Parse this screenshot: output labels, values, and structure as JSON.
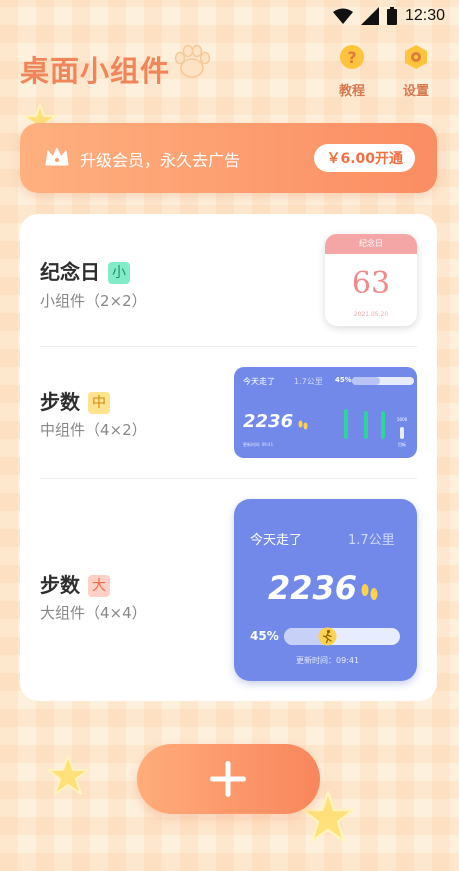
{
  "status_bar": {
    "time": "12:30"
  },
  "header": {
    "title": "桌面小组件",
    "tutorial_label": "教程",
    "settings_label": "设置"
  },
  "promo": {
    "text": "升级会员，永久去广告",
    "button_label": "￥6.00开通"
  },
  "widgets": [
    {
      "title": "纪念日",
      "size_badge": "小",
      "subtitle": "小组件（2×2）",
      "preview": {
        "header": "纪念日",
        "number": "63",
        "date": "2021.05.20"
      }
    },
    {
      "title": "步数",
      "size_badge": "中",
      "subtitle": "中组件（4×2）",
      "preview": {
        "heading": "今天走了",
        "distance": "1.7公里",
        "percent": "45%",
        "steps": "2236",
        "updated": "更新时间: 09:41",
        "goal_label": "目标",
        "goal_value": "5000",
        "progress": 0.45
      }
    },
    {
      "title": "步数",
      "size_badge": "大",
      "subtitle": "大组件（4×4）",
      "preview": {
        "heading": "今天走了",
        "distance": "1.7公里",
        "steps": "2236",
        "percent": "45%",
        "updated": "更新时间：09:41",
        "progress": 0.45
      }
    }
  ],
  "add_button": {
    "icon": "plus-icon"
  },
  "colors": {
    "accent": "#f0855a",
    "widget_blue": "#7289ea",
    "promo_gradient": [
      "#ffb07f",
      "#fb8d63"
    ]
  }
}
